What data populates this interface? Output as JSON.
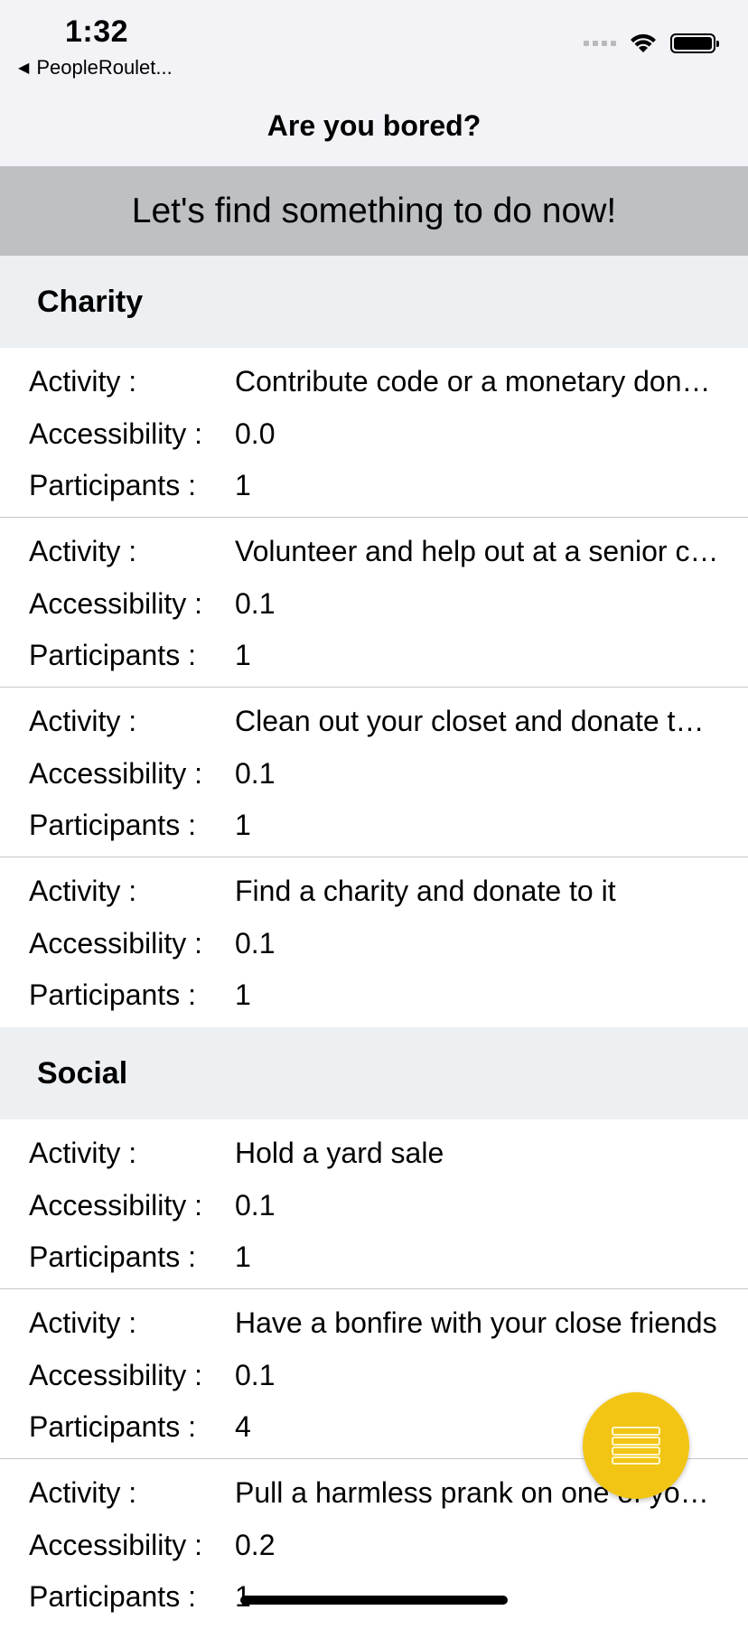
{
  "status": {
    "time": "1:32",
    "back_label": "PeopleRoulet..."
  },
  "nav": {
    "title": "Are you bored?"
  },
  "banner": {
    "text": "Let's find something to do now!"
  },
  "labels": {
    "activity": "Activity :",
    "accessibility": "Accessibility :",
    "participants": "Participants :"
  },
  "sections": [
    {
      "title": "Charity",
      "items": [
        {
          "activity": "Contribute code or a monetary donation to an open-source software project",
          "accessibility": "0.0",
          "participants": "1"
        },
        {
          "activity": "Volunteer and help out at a senior citizen center",
          "accessibility": "0.1",
          "participants": "1"
        },
        {
          "activity": "Clean out your closet and donate the clothes you've outgrown",
          "accessibility": "0.1",
          "participants": "1"
        },
        {
          "activity": "Find a charity and donate to it",
          "accessibility": "0.1",
          "participants": "1"
        }
      ]
    },
    {
      "title": "Social",
      "items": [
        {
          "activity": "Hold a yard sale",
          "accessibility": "0.1",
          "participants": "1"
        },
        {
          "activity": "Have a bonfire with your close friends",
          "accessibility": "0.1",
          "participants": "4"
        },
        {
          "activity": "Pull a harmless prank on one of your friends",
          "accessibility": "0.2",
          "participants": "1"
        }
      ]
    }
  ],
  "fab": {
    "icon": "menu-icon",
    "color": "#f2c515"
  }
}
